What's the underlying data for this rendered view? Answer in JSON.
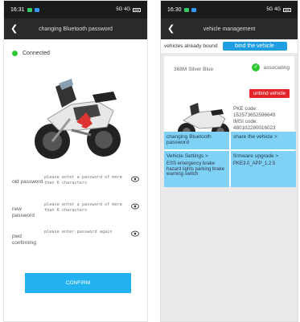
{
  "left_screen": {
    "status": {
      "time": "16:31",
      "indicators": "5G 4G"
    },
    "nav": {
      "title": "changing Bluetooth password"
    },
    "connection": {
      "label": "Connected"
    },
    "fields": [
      {
        "label": "old password",
        "placeholder": "please enter a password of more than 6 characters"
      },
      {
        "label": "new password",
        "placeholder": "please enter a password of more than 6 characters"
      },
      {
        "label": "pwd confirming",
        "placeholder": "please enter password again"
      }
    ],
    "confirm_label": "CONFIRM"
  },
  "right_screen": {
    "status": {
      "time": "16:30",
      "indicators": "5G 4G"
    },
    "nav": {
      "title": "vehicle management"
    },
    "bound_label": "vehicles already bound",
    "bind_button": "bind the vehicle",
    "vehicle": {
      "name": "368M Silver Blue",
      "status": "associating",
      "unbind": "unbind vehicle",
      "pke_label": "PKE code:",
      "pke_code": "152573652596649",
      "imsi_label": "IMSI code:",
      "imsi_code": "480102280016023"
    },
    "tiles": {
      "change_pw": "changing Bluetooth password",
      "share": "share the vehicle >",
      "settings": "Vehicle Settings >",
      "settings_sub": "ESS emergency brake hazard lights parking brake warning switch",
      "firmware": "firmware upgrade >",
      "firmware_version": "PKE3.0_APP_1.2.5"
    }
  },
  "colors": {
    "accent": "#22b2ef",
    "tile": "#7fd2f5",
    "danger": "#e3242b",
    "success": "#2ec931",
    "nav": "#2a2a2a"
  }
}
